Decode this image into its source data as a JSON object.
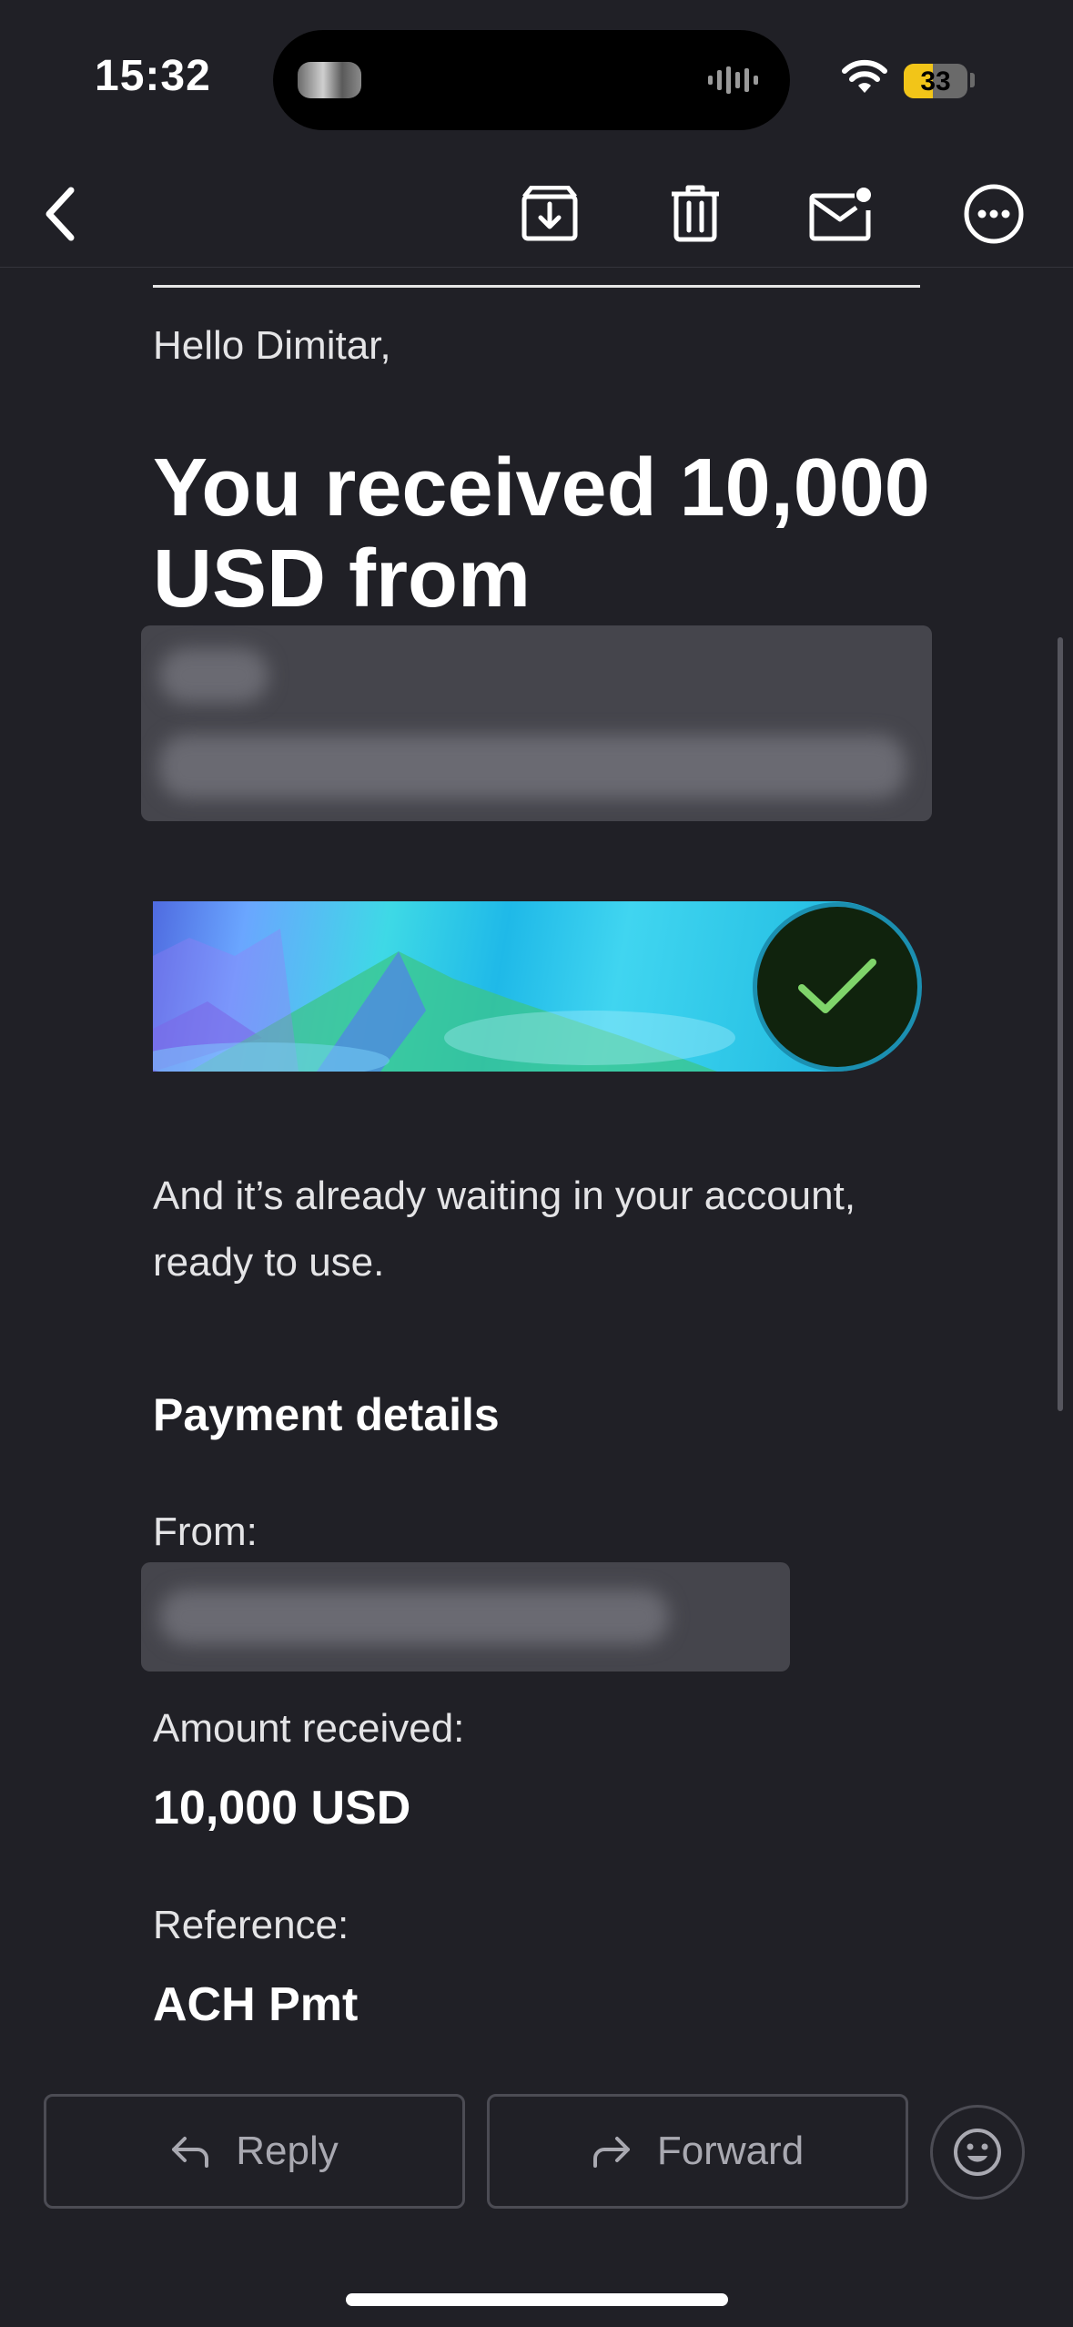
{
  "status_bar": {
    "time": "15:32",
    "battery": "33"
  },
  "toolbar": {
    "back_icon": "chevron-left-icon",
    "archive_icon": "archive-icon",
    "trash_icon": "trash-icon",
    "mark_unread_icon": "mail-unread-icon",
    "more_icon": "more-icon"
  },
  "email": {
    "greeting": "Hello Dimitar,",
    "headline": "You received 10,000 USD from",
    "body": "And it’s already waiting in your account, ready to use.",
    "section_title": "Payment details",
    "details": [
      {
        "label": "From:",
        "value": ""
      },
      {
        "label": "Amount received:",
        "value": "10,000 USD"
      },
      {
        "label": "Reference:",
        "value": "ACH Pmt"
      }
    ]
  },
  "actions": {
    "reply": "Reply",
    "forward": "Forward",
    "emoji_icon": "smiley-icon"
  },
  "colors": {
    "background": "#202026",
    "accent_check": "#7fd46a",
    "badge_bg": "#10230d"
  }
}
